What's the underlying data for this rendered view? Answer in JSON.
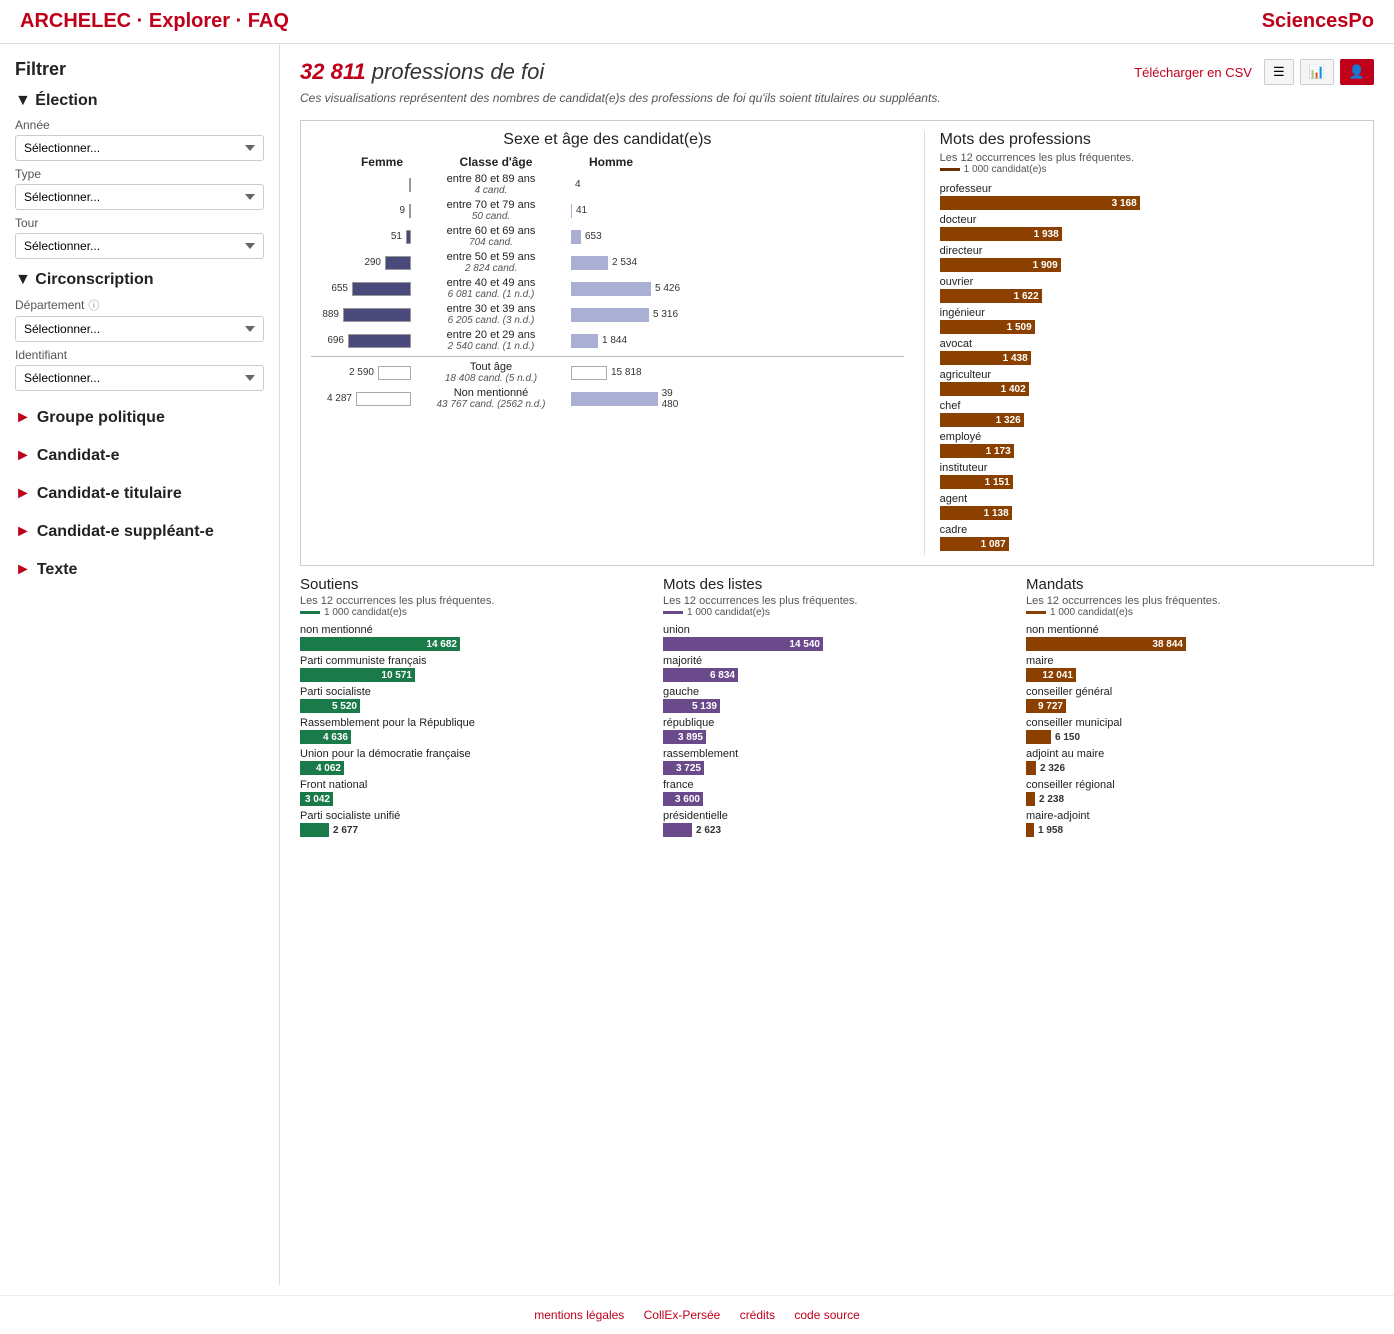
{
  "header": {
    "title": "ARCHELEC · Explorer · FAQ",
    "logo": "SciencesPo"
  },
  "sidebar": {
    "title": "Filtrer",
    "election": {
      "label": "▼ Élection",
      "annee": {
        "label": "Année",
        "placeholder": "Sélectionner..."
      },
      "type": {
        "label": "Type",
        "placeholder": "Sélectionner..."
      },
      "tour": {
        "label": "Tour",
        "placeholder": "Sélectionner..."
      }
    },
    "circonscription": {
      "label": "▼ Circonscription",
      "departement": {
        "label": "Département",
        "placeholder": "Sélectionner..."
      },
      "identifiant": {
        "label": "Identifiant",
        "placeholder": "Sélectionner..."
      }
    },
    "collapsibles": [
      "► Groupe politique",
      "► Candidat-e",
      "► Candidat-e titulaire",
      "► Candidat-e suppléant-e",
      "► Texte"
    ]
  },
  "main": {
    "count": "32 811",
    "title_suffix": "professions de foi",
    "subtitle": "Ces visualisations représentent des nombres de candidat(e)s des professions de foi qu'ils soient titulaires ou suppléants.",
    "download": "Télécharger en CSV",
    "toolbar_buttons": [
      "table-icon",
      "chart-icon",
      "person-icon"
    ],
    "age_sex_chart": {
      "title": "Sexe et âge des candidat(e)s",
      "headers": [
        "Femme",
        "Classe d'âge",
        "Homme"
      ],
      "rows": [
        {
          "age": "entre 80 et 89 ans",
          "cand": "4 cand.",
          "female": 0,
          "female_val": "",
          "male": 4,
          "male_val": "4",
          "female_bar_w": 0,
          "male_bar_w": 4
        },
        {
          "age": "entre 70 et 79 ans",
          "cand": "50 cand.",
          "female": 9,
          "female_val": "9",
          "male": 41,
          "male_val": "41",
          "female_bar_w": 9,
          "male_bar_w": 41
        },
        {
          "age": "entre 60 et 69 ans",
          "cand": "704 cand.",
          "female": 51,
          "female_val": "51",
          "male": 653,
          "male_val": "653",
          "female_bar_w": 8,
          "male_bar_w": 65
        },
        {
          "age": "entre 50 et 59 ans",
          "cand": "2 824 cand.",
          "female": 290,
          "female_val": "290",
          "male": 2534,
          "male_val": "2 534",
          "female_bar_w": 25,
          "male_bar_w": 75
        },
        {
          "age": "entre 40 et 49 ans",
          "cand": "6 081 cand. (1 n.d.)",
          "female": 655,
          "female_val": "655",
          "male": 5426,
          "male_val": "5 426",
          "female_bar_w": 40,
          "male_bar_w": 90
        },
        {
          "age": "entre 30 et 39 ans",
          "cand": "6 205 cand. (3 n.d.)",
          "female": 889,
          "female_val": "889",
          "male": 5316,
          "male_val": "5 316",
          "female_bar_w": 45,
          "male_bar_w": 88
        },
        {
          "age": "entre 20 et 29 ans",
          "cand": "2 540 cand. (1 n.d.)",
          "female": 696,
          "female_val": "696",
          "male": 1844,
          "male_val": "1 844",
          "female_bar_w": 38,
          "male_bar_w": 72
        }
      ],
      "totals": [
        {
          "label": "Tout âge",
          "cand": "18 408 cand. (5 n.d.)",
          "female": 2590,
          "female_val": "2 590",
          "male": 15818,
          "male_val": "15 818"
        },
        {
          "label": "Non mentionné",
          "cand": "43 767 cand. (2562 n.d.)",
          "female": 4287,
          "female_val": "4 287",
          "male": 39480,
          "male_val": "39 480"
        }
      ]
    },
    "mots_professions": {
      "title": "Mots des professions",
      "subtitle": "Les 12 occurrences les plus fréquentes.",
      "legend": "1 000 candidat(e)s",
      "max_val": 3168,
      "max_width": 200,
      "items": [
        {
          "label": "professeur",
          "value": 3168,
          "display": "3 168"
        },
        {
          "label": "docteur",
          "value": 1938,
          "display": "1 938"
        },
        {
          "label": "directeur",
          "value": 1909,
          "display": "1 909"
        },
        {
          "label": "ouvrier",
          "value": 1622,
          "display": "1 622"
        },
        {
          "label": "ingénieur",
          "value": 1509,
          "display": "1 509"
        },
        {
          "label": "avocat",
          "value": 1438,
          "display": "1 438"
        },
        {
          "label": "agriculteur",
          "value": 1402,
          "display": "1 402"
        },
        {
          "label": "chef",
          "value": 1326,
          "display": "1 326"
        },
        {
          "label": "employé",
          "value": 1173,
          "display": "1 173"
        },
        {
          "label": "instituteur",
          "value": 1151,
          "display": "1 151"
        },
        {
          "label": "agent",
          "value": 1138,
          "display": "1 138"
        },
        {
          "label": "cadre",
          "value": 1087,
          "display": "1 087"
        }
      ]
    },
    "soutiens": {
      "title": "Soutiens",
      "subtitle": "Les 12 occurrences les plus fréquentes.",
      "legend": "1 000 candidat(e)s",
      "max_val": 14682,
      "max_width": 160,
      "items": [
        {
          "label": "non mentionné",
          "value": 14682,
          "display": "14 682"
        },
        {
          "label": "Parti communiste français",
          "value": 10571,
          "display": "10 571"
        },
        {
          "label": "Parti socialiste",
          "value": 5520,
          "display": "5 520"
        },
        {
          "label": "Rassemblement pour la République",
          "value": 4636,
          "display": "4 636"
        },
        {
          "label": "Union pour la démocratie française",
          "value": 4062,
          "display": "4 062"
        },
        {
          "label": "Front national",
          "value": 3042,
          "display": "3 042"
        },
        {
          "label": "Parti socialiste unifié",
          "value": 2677,
          "display": "2 677"
        }
      ]
    },
    "mots_listes": {
      "title": "Mots des listes",
      "subtitle": "Les 12 occurrences les plus fréquentes.",
      "legend": "1 000 candidat(e)s",
      "max_val": 14540,
      "max_width": 160,
      "items": [
        {
          "label": "union",
          "value": 14540,
          "display": "14 540"
        },
        {
          "label": "majorité",
          "value": 6834,
          "display": "6 834"
        },
        {
          "label": "gauche",
          "value": 5139,
          "display": "5 139"
        },
        {
          "label": "république",
          "value": 3895,
          "display": "3 895"
        },
        {
          "label": "rassemblement",
          "value": 3725,
          "display": "3 725"
        },
        {
          "label": "france",
          "value": 3600,
          "display": "3 600"
        },
        {
          "label": "présidentielle",
          "value": 2623,
          "display": "2 623"
        }
      ]
    },
    "mandats": {
      "title": "Mandats",
      "subtitle": "Les 12 occurrences les plus fréquentes.",
      "legend": "1 000 candidat(e)s",
      "max_val": 38844,
      "max_width": 160,
      "items": [
        {
          "label": "non mentionné",
          "value": 38844,
          "display": "38 844"
        },
        {
          "label": "maire",
          "value": 12041,
          "display": "12 041"
        },
        {
          "label": "conseiller général",
          "value": 9727,
          "display": "9 727"
        },
        {
          "label": "conseiller municipal",
          "value": 6150,
          "display": "6 150"
        },
        {
          "label": "adjoint au maire",
          "value": 2326,
          "display": "2 326"
        },
        {
          "label": "conseiller régional",
          "value": 2238,
          "display": "2 238"
        },
        {
          "label": "maire-adjoint",
          "value": 1958,
          "display": "1 958"
        }
      ]
    }
  },
  "footer": {
    "links": [
      "mentions légales",
      "CollEx-Persée",
      "crédits",
      "code source"
    ]
  }
}
